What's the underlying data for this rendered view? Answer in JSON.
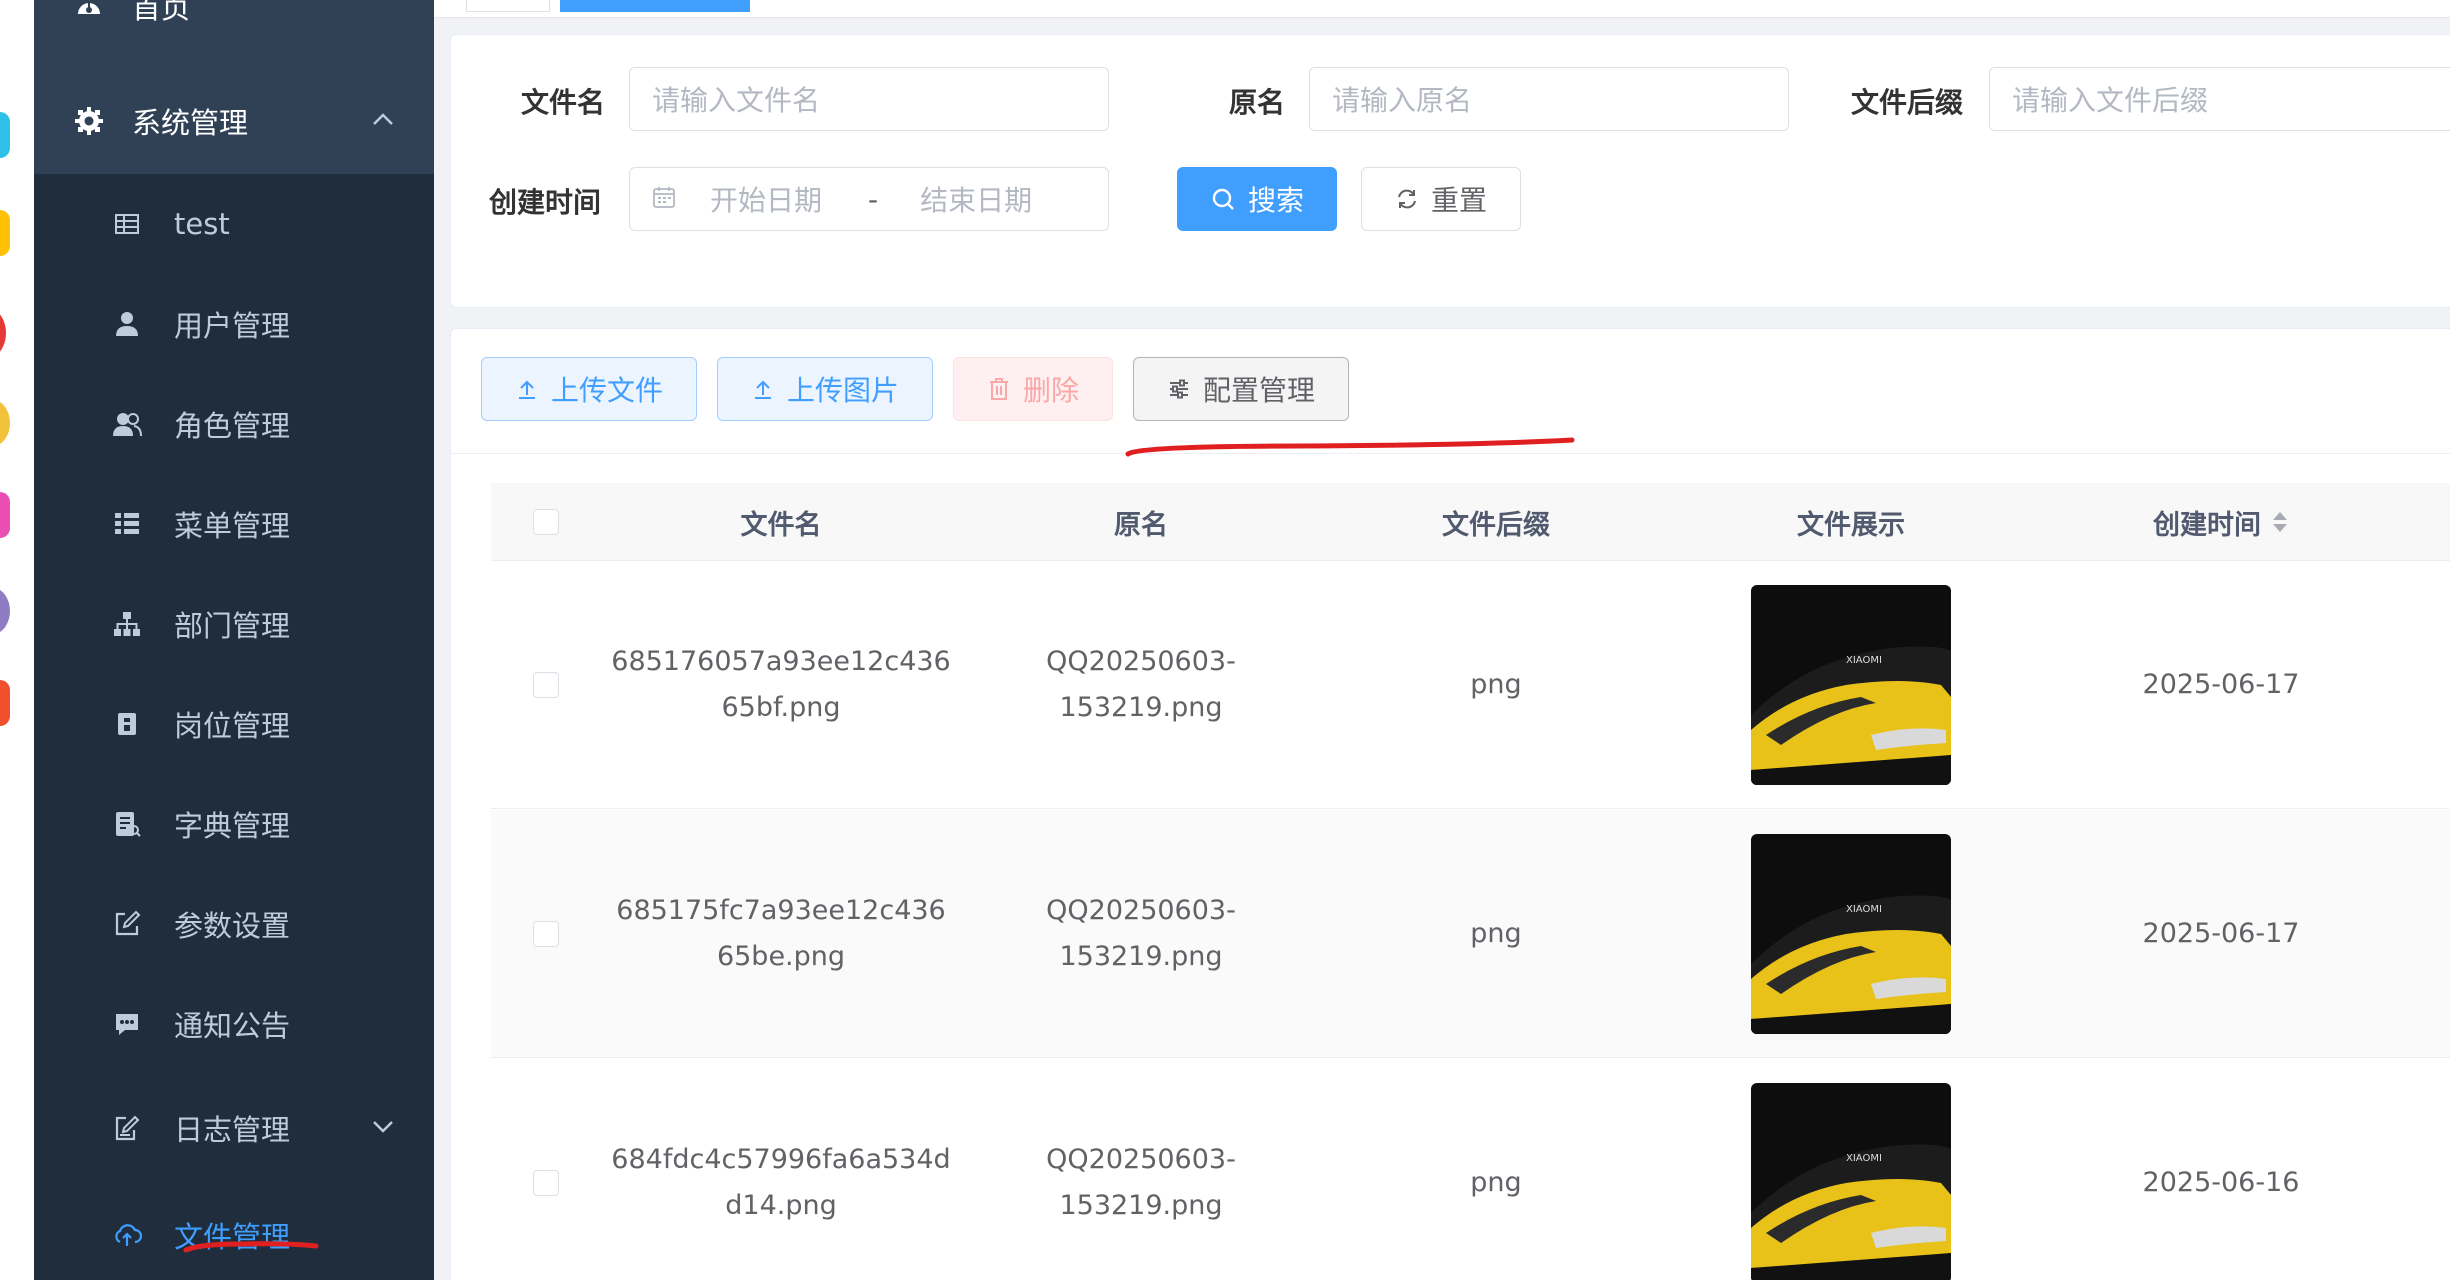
{
  "sidebar": {
    "home_label": "首页",
    "system_label": "系统管理",
    "items": [
      {
        "label": "test",
        "icon": "table-icon"
      },
      {
        "label": "用户管理",
        "icon": "user-icon"
      },
      {
        "label": "角色管理",
        "icon": "peoples-icon"
      },
      {
        "label": "菜单管理",
        "icon": "tree-table-icon"
      },
      {
        "label": "部门管理",
        "icon": "tree-icon"
      },
      {
        "label": "岗位管理",
        "icon": "post-icon"
      },
      {
        "label": "字典管理",
        "icon": "dict-icon"
      },
      {
        "label": "参数设置",
        "icon": "edit-icon"
      },
      {
        "label": "通知公告",
        "icon": "message-icon"
      },
      {
        "label": "日志管理",
        "icon": "log-icon"
      },
      {
        "label": "文件管理",
        "icon": "upload-cloud-icon"
      }
    ],
    "active_item": "文件管理",
    "bg_color": "#304156",
    "sub_bg_color": "#1f2d3d",
    "active_color": "#409eff"
  },
  "search": {
    "filename_label": "文件名",
    "filename_placeholder": "请输入文件名",
    "original_label": "原名",
    "original_placeholder": "请输入原名",
    "suffix_label": "文件后缀",
    "suffix_placeholder": "请输入文件后缀",
    "created_label": "创建时间",
    "start_placeholder": "开始日期",
    "range_separator": "-",
    "end_placeholder": "结束日期",
    "search_button": "搜索",
    "reset_button": "重置"
  },
  "toolbar": {
    "upload_file": "上传文件",
    "upload_image": "上传图片",
    "delete": "删除",
    "config": "配置管理"
  },
  "table": {
    "columns": [
      "文件名",
      "原名",
      "文件后缀",
      "文件展示",
      "创建时间"
    ],
    "rows": [
      {
        "filename_l1": "685176057a93ee12c436",
        "filename_l2": "65bf.png",
        "original_l1": "QQ20250603-",
        "original_l2": "153219.png",
        "suffix": "png",
        "created": "2025-06-17"
      },
      {
        "filename_l1": "685175fc7a93ee12c436",
        "filename_l2": "65be.png",
        "original_l1": "QQ20250603-",
        "original_l2": "153219.png",
        "suffix": "png",
        "created": "2025-06-17"
      },
      {
        "filename_l1": "684fdc4c57996fa6a534d",
        "filename_l2": "d14.png",
        "original_l1": "QQ20250603-",
        "original_l2": "153219.png",
        "suffix": "png",
        "created": "2025-06-16"
      }
    ],
    "thumb_text": "XIAOMI"
  },
  "colors": {
    "primary": "#409eff",
    "annotation_red": "#e02020"
  }
}
